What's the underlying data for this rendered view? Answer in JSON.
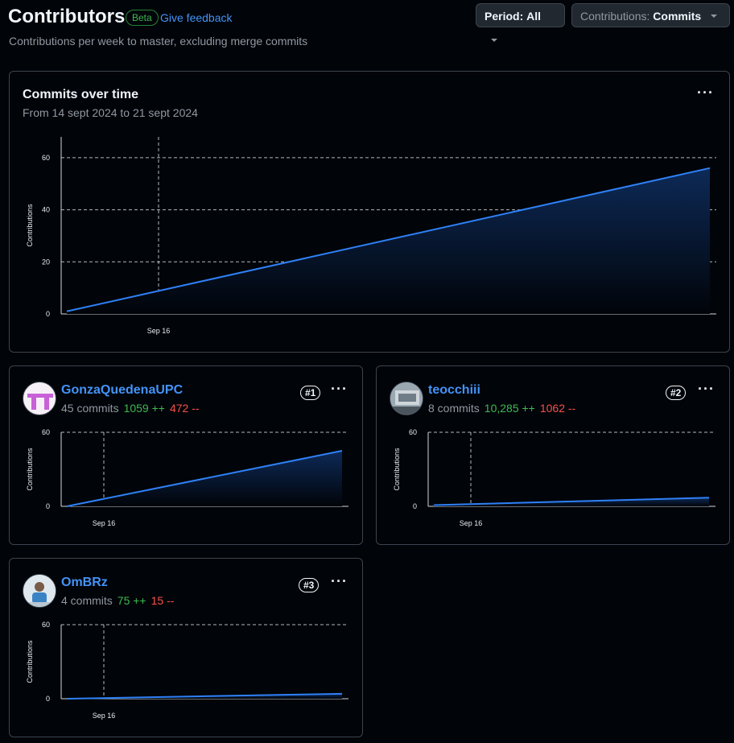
{
  "header": {
    "title": "Contributors",
    "beta": "Beta",
    "feedback": "Give feedback",
    "subtitle": "Contributions per week to master, excluding merge commits"
  },
  "filters": {
    "period_label": "Period:",
    "period_value": "All",
    "contrib_label": "Contributions:",
    "contrib_value": "Commits"
  },
  "main_chart": {
    "title": "Commits over time",
    "range": "From 14 sept 2024 to 21 sept 2024",
    "more_icon": "kebab-horizontal-icon"
  },
  "contributors": [
    {
      "name": "GonzaQuedenaUPC",
      "commits": "45 commits",
      "additions": "1059 ++",
      "deletions": "472 --",
      "rank": "#1"
    },
    {
      "name": "teocchiii",
      "commits": "8 commits",
      "additions": "10,285 ++",
      "deletions": "1062 --",
      "rank": "#2"
    },
    {
      "name": "OmBRz",
      "commits": "4 commits",
      "additions": "75 ++",
      "deletions": "15 --",
      "rank": "#3"
    }
  ],
  "colors": {
    "line": "#2f81f7",
    "add": "#3fb950",
    "del": "#f85149",
    "link": "#4493f8"
  },
  "chart_data": [
    {
      "type": "area",
      "x": [
        "Sep 14",
        "Sep 21"
      ],
      "values": [
        1,
        56
      ],
      "ylim": [
        0,
        68
      ],
      "yticks": [
        0,
        20,
        40,
        60
      ],
      "xticks": [
        "Sep 16"
      ],
      "ylabel": "Contributions",
      "grid": true
    },
    {
      "type": "area",
      "x": [
        "Sep 14",
        "Sep 21"
      ],
      "values": [
        0,
        45
      ],
      "ylim": [
        0,
        60
      ],
      "yticks": [
        0,
        60
      ],
      "xticks": [
        "Sep 16"
      ],
      "ylabel": "Contributions",
      "grid": true
    },
    {
      "type": "area",
      "x": [
        "Sep 14",
        "Sep 21"
      ],
      "values": [
        1,
        7
      ],
      "ylim": [
        0,
        60
      ],
      "yticks": [
        0,
        60
      ],
      "xticks": [
        "Sep 16"
      ],
      "ylabel": "Contributions",
      "grid": true
    },
    {
      "type": "area",
      "x": [
        "Sep 14",
        "Sep 21"
      ],
      "values": [
        0,
        4
      ],
      "ylim": [
        0,
        60
      ],
      "yticks": [
        0,
        60
      ],
      "xticks": [
        "Sep 16"
      ],
      "ylabel": "Contributions",
      "grid": true
    }
  ]
}
